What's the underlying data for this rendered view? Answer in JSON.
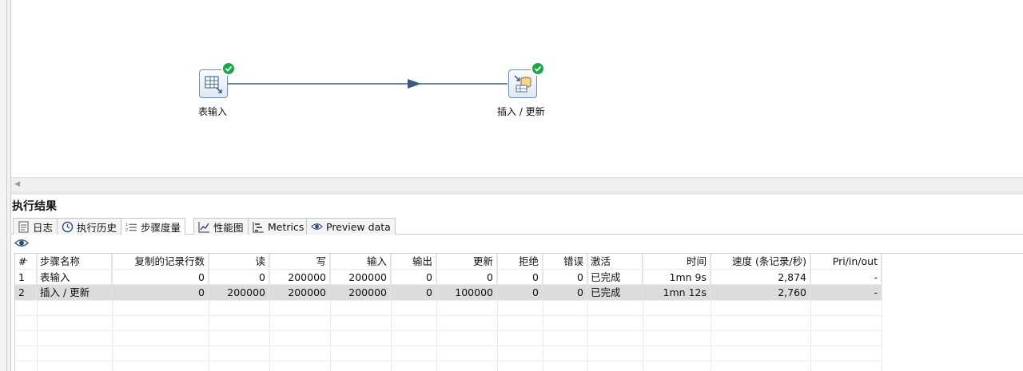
{
  "canvas": {
    "steps": [
      {
        "label": "表输入",
        "icon": "table-input-icon",
        "status": "ok"
      },
      {
        "label": "插入 / 更新",
        "icon": "insert-update-icon",
        "status": "ok"
      }
    ]
  },
  "results": {
    "title": "执行结果",
    "tabs": [
      {
        "label": "日志",
        "icon": "log-icon"
      },
      {
        "label": "执行历史",
        "icon": "history-icon"
      },
      {
        "label": "步骤度量",
        "icon": "step-metrics-icon",
        "active": true
      },
      {
        "label": "性能图",
        "icon": "performance-chart-icon"
      },
      {
        "label": "Metrics",
        "icon": "metrics-icon"
      },
      {
        "label": "Preview data",
        "icon": "preview-eye-icon"
      }
    ],
    "table": {
      "headers": [
        "#",
        "步骤名称",
        "复制的记录行数",
        "读",
        "写",
        "输入",
        "输出",
        "更新",
        "拒绝",
        "错误",
        "激活",
        "时间",
        "速度 (条记录/秒)",
        "Pri/in/out"
      ],
      "rows": [
        [
          "1",
          "表输入",
          "0",
          "0",
          "200000",
          "200000",
          "0",
          "0",
          "0",
          "0",
          "已完成",
          "1mn 9s",
          "2,874",
          "-"
        ],
        [
          "2",
          "插入 / 更新",
          "0",
          "200000",
          "200000",
          "200000",
          "0",
          "100000",
          "0",
          "0",
          "已完成",
          "1mn 12s",
          "2,760",
          "-"
        ]
      ]
    }
  },
  "colors": {
    "success": "#1fa64a",
    "hop": "#3d5a80",
    "selected_row": "#dcdcdc"
  }
}
